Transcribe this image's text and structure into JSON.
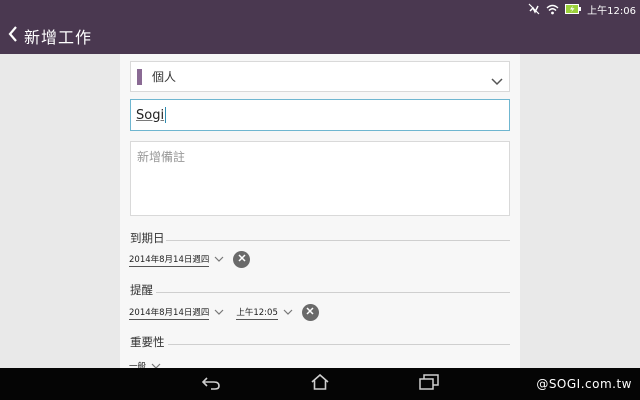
{
  "status_bar": {
    "time": "上午12:06",
    "icons": [
      "mute-icon",
      "wifi-icon",
      "battery-charging-icon"
    ]
  },
  "app_bar": {
    "title": "新增工作",
    "back_icon": "chevron-left-icon"
  },
  "form": {
    "category": {
      "label": "個人",
      "color": "#8a6a94"
    },
    "title_value": "Sogi",
    "note_placeholder": "新增備註",
    "due_date": {
      "section_label": "到期日",
      "date": "2014年8月14日週四"
    },
    "reminder": {
      "section_label": "提醒",
      "date": "2014年8月14日週四",
      "time": "上午12:05"
    },
    "importance": {
      "section_label": "重要性",
      "value": "一般"
    }
  },
  "nav_bar": {
    "buttons": [
      "back-icon",
      "home-icon",
      "recent-apps-icon"
    ]
  },
  "watermark": "@SOGI.com.tw",
  "colors": {
    "app_bar": "#4a3850",
    "input_focus": "#6fb6d0"
  }
}
